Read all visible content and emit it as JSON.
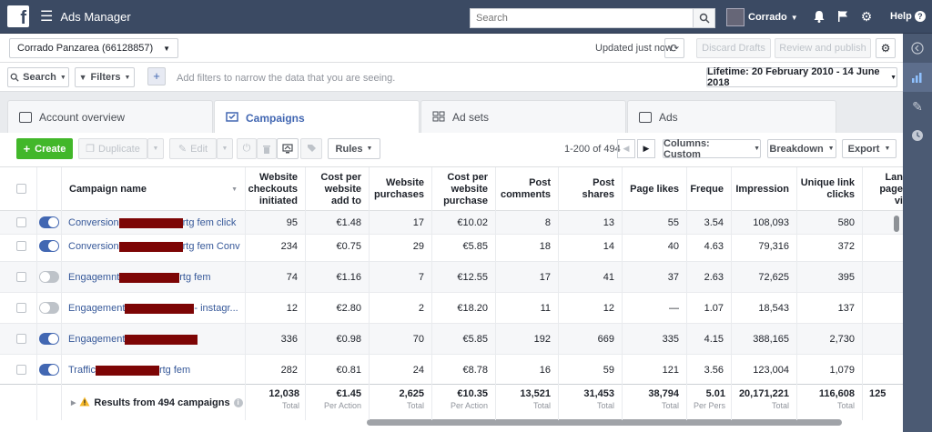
{
  "topbar": {
    "logo": "f",
    "app_title": "Ads Manager",
    "search_placeholder": "Search",
    "user_name": "Corrado",
    "help_label": "Help",
    "help_icon": "?"
  },
  "account_bar": {
    "account_name": "Corrado Panzarea (66128857)",
    "updated_text": "Updated just now",
    "discard_label": "Discard Drafts",
    "review_label": "Review and publish"
  },
  "filter_bar": {
    "search_label": "Search",
    "filters_label": "Filters",
    "add_label": "+",
    "hint": "Add filters to narrow the data that you are seeing.",
    "lifetime_label": "Lifetime: 20 February 2010 - 14 June 2018"
  },
  "tabs": [
    {
      "label": "Account overview"
    },
    {
      "label": "Campaigns"
    },
    {
      "label": "Ad sets"
    },
    {
      "label": "Ads"
    }
  ],
  "toolbar": {
    "create_label": "Create",
    "duplicate_label": "Duplicate",
    "edit_label": "Edit",
    "rules_label": "Rules",
    "pager_text": "1-200 of 494",
    "columns_label": "Columns: Custom",
    "breakdown_label": "Breakdown",
    "export_label": "Export"
  },
  "table": {
    "headers": {
      "name": "Campaign name",
      "c1": "Website checkouts initiated",
      "c2": "Cost per website add to",
      "c3": "Website purchases",
      "c4": "Cost per website purchase",
      "c5": "Post comments",
      "c6": "Post shares",
      "c7": "Page likes",
      "c8": "Freque",
      "c9": "Impression",
      "c10": "Unique link clicks",
      "c11": "Lan page vi"
    },
    "rows": [
      {
        "pre": "Conversion",
        "post": "rtg fem click",
        "on": true,
        "c1": "95",
        "c2": "€1.48",
        "c3": "17",
        "c4": "€10.02",
        "c5": "8",
        "c6": "13",
        "c7": "55",
        "c8": "3.54",
        "c9": "108,093",
        "c10": "580"
      },
      {
        "pre": "Conversion",
        "post": "rtg fem Conv",
        "on": true,
        "c1": "234",
        "c2": "€0.75",
        "c3": "29",
        "c4": "€5.85",
        "c5": "18",
        "c6": "14",
        "c7": "40",
        "c8": "4.63",
        "c9": "79,316",
        "c10": "372"
      },
      {
        "pre": "Engagemnt",
        "post": "rtg fem",
        "on": false,
        "c1": "74",
        "c2": "€1.16",
        "c3": "7",
        "c4": "€12.55",
        "c5": "17",
        "c6": "41",
        "c7": "37",
        "c8": "2.63",
        "c9": "72,625",
        "c10": "395"
      },
      {
        "pre": "Engagement",
        "post": "- instagr...",
        "on": false,
        "c1": "12",
        "c2": "€2.80",
        "c3": "2",
        "c4": "€18.20",
        "c5": "11",
        "c6": "12",
        "c7": "—",
        "c8": "1.07",
        "c9": "18,543",
        "c10": "137"
      },
      {
        "pre": "Engagement",
        "post": "",
        "on": true,
        "c1": "336",
        "c2": "€0.98",
        "c3": "70",
        "c4": "€5.85",
        "c5": "192",
        "c6": "669",
        "c7": "335",
        "c8": "4.15",
        "c9": "388,165",
        "c10": "2,730"
      },
      {
        "pre": "Traffic",
        "post": "rtg fem",
        "on": true,
        "c1": "282",
        "c2": "€0.81",
        "c3": "24",
        "c4": "€8.78",
        "c5": "16",
        "c6": "59",
        "c7": "121",
        "c8": "3.56",
        "c9": "123,004",
        "c10": "1,079"
      }
    ],
    "footer": {
      "label": "Results from 494 campaigns",
      "c1": "12,038",
      "c1s": "Total",
      "c2": "€1.45",
      "c2s": "Per Action",
      "c3": "2,625",
      "c3s": "Total",
      "c4": "€10.35",
      "c4s": "Per Action",
      "c5": "13,521",
      "c5s": "Total",
      "c6": "31,453",
      "c6s": "Total",
      "c7": "38,794",
      "c7s": "Total",
      "c8": "5.01",
      "c8s": "Per Pers",
      "c9": "20,171,221",
      "c9s": "Total",
      "c10": "116,608",
      "c10s": "Total",
      "c11": "125"
    }
  }
}
